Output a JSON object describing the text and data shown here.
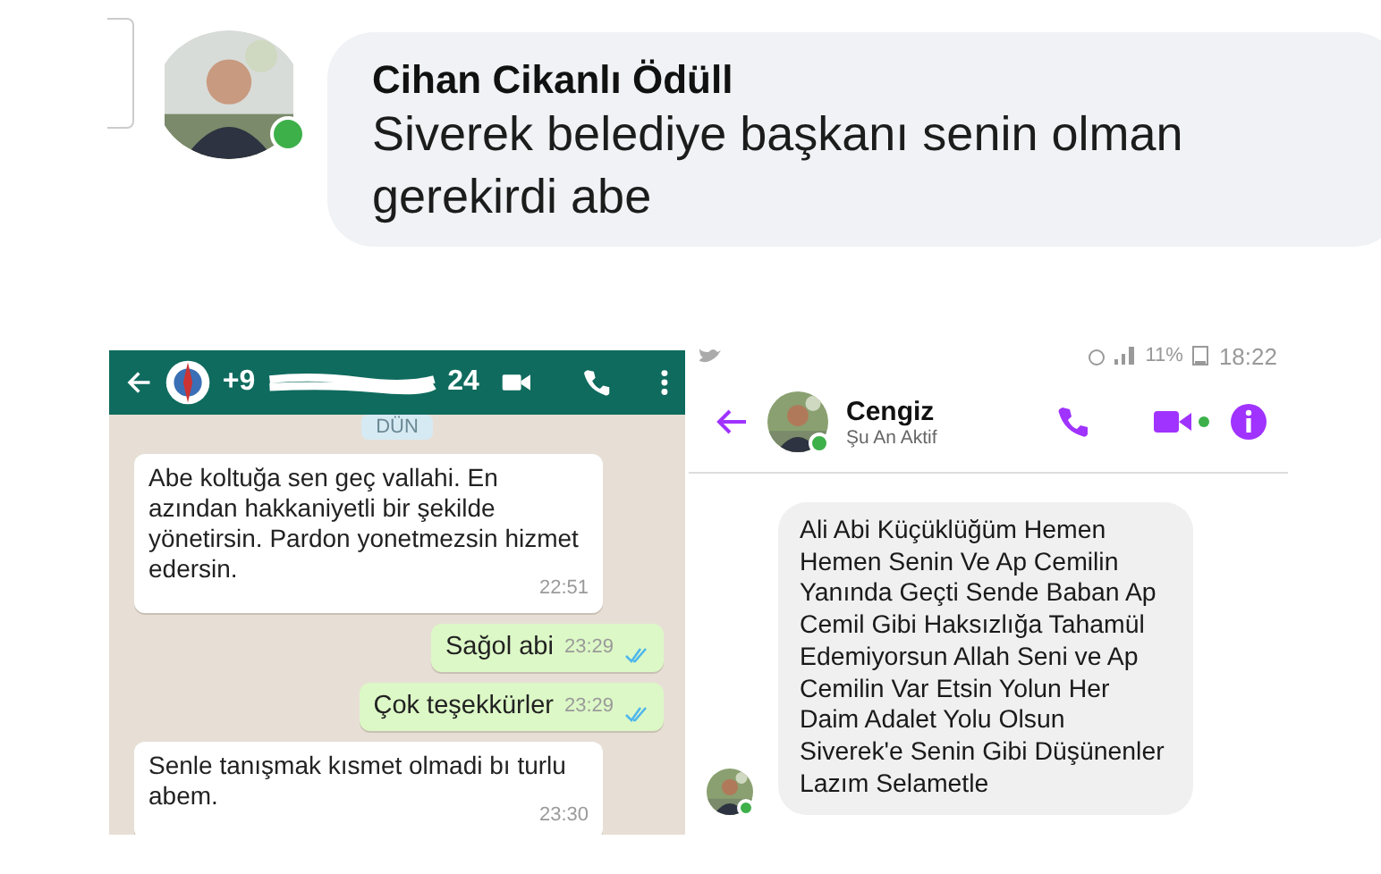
{
  "comment": {
    "author": "Cihan Cikanlı Ödüll",
    "text": "Siverek belediye başkanı senin olman gerekirdi abe",
    "online": true
  },
  "whatsapp": {
    "title_start": "+9",
    "title_end": "24",
    "date_chip": "DÜN",
    "messages": [
      {
        "kind": "received",
        "text": "Abe koltuğa sen geç vallahi.  En azından hakkaniyetli bir şekilde yönetirsin. Pardon yonetmezsin hizmet edersin.",
        "time": "22:51"
      },
      {
        "kind": "sent",
        "text": "Sağol abi",
        "time": "23:29",
        "read": true
      },
      {
        "kind": "sent",
        "text": "Çok teşekkürler",
        "time": "23:29",
        "read": true
      },
      {
        "kind": "received",
        "text": "Senle tanışmak kısmet olmadi bı turlu abem.",
        "time": "23:30"
      }
    ]
  },
  "messenger": {
    "status_bar": {
      "battery": "11%",
      "time": "18:22"
    },
    "contact": "Cengiz",
    "presence": "Şu An Aktif",
    "online": true,
    "message": "Ali Abi Küçüklüğüm Hemen Hemen Senin Ve Ap Cemilin Yanında Geçti Sende Baban Ap Cemil Gibi Haksızlığa Tahamül Edemiyorsun Allah Seni ve Ap Cemilin Var Etsin Yolun Her Daim Adalet Yolu Olsun Siverek'e Senin Gibi Düşünenler Lazım Selametle"
  }
}
